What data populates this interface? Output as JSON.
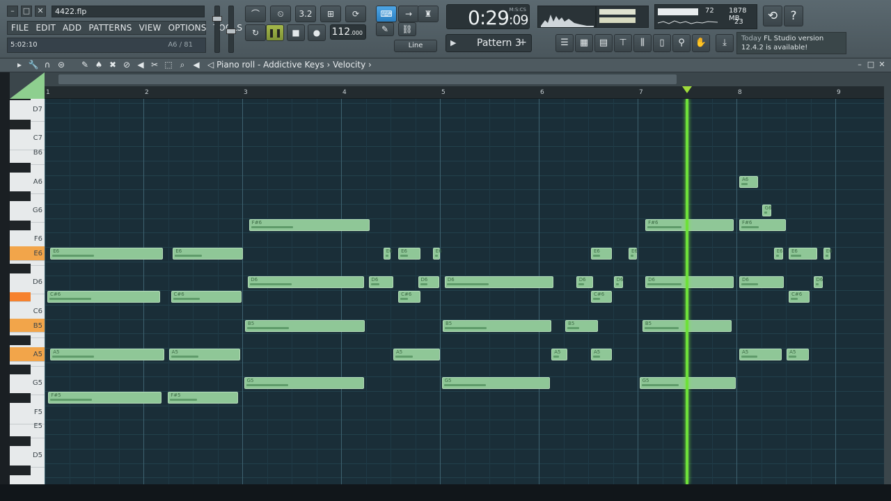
{
  "window": {
    "filename": "4422.flp"
  },
  "menu": [
    "FILE",
    "EDIT",
    "ADD",
    "PATTERNS",
    "VIEW",
    "OPTIONS",
    "TOOLS",
    "?"
  ],
  "hint": {
    "left": "5:02:10",
    "right": "A6 / 81"
  },
  "transport": {
    "tempo_main": "112",
    "tempo_decimal": ".000",
    "snap_label": "Line",
    "counter_label": "3.2"
  },
  "time": {
    "main": "0:29",
    "sub": ":09",
    "format": "M:S:CS"
  },
  "cpu": {
    "cpu_value": "72",
    "memory": "1878 MB",
    "voices": "23"
  },
  "pattern": {
    "label": "Pattern 3"
  },
  "news": {
    "today": "Today",
    "line1": "FL Studio version",
    "line2": "12.4.2 is available!"
  },
  "pianoroll": {
    "breadcrumb": "Piano roll - Addictive Keys",
    "sep": "›",
    "target": "Velocity"
  },
  "bars": [
    "1",
    "2",
    "3",
    "4",
    "5",
    "6",
    "7",
    "8",
    "9"
  ],
  "key_labels": [
    "D7",
    "C7",
    "B6",
    "A6",
    "G6",
    "F6",
    "E6",
    "D6",
    "C6",
    "B5",
    "A5",
    "G5",
    "F5",
    "E5",
    "D5"
  ],
  "notes": [
    {
      "n": "E6",
      "b": 0.03,
      "len": 1.17
    },
    {
      "n": "E6",
      "b": 1.27,
      "len": 0.74
    },
    {
      "n": "E6",
      "b": 3.4,
      "len": 0.1
    },
    {
      "n": "E6",
      "b": 3.55,
      "len": 0.25
    },
    {
      "n": "E6",
      "b": 3.9,
      "len": 0.1
    },
    {
      "n": "E6",
      "b": 5.5,
      "len": 0.24
    },
    {
      "n": "E6",
      "b": 5.88,
      "len": 0.11
    },
    {
      "n": "E6",
      "b": 7.35,
      "len": 0.12
    },
    {
      "n": "E6",
      "b": 7.5,
      "len": 0.32
    },
    {
      "n": "E6",
      "b": 7.85,
      "len": 0.1
    },
    {
      "n": "C#6",
      "b": 0.0,
      "len": 1.17
    },
    {
      "n": "C#6",
      "b": 1.25,
      "len": 0.74
    },
    {
      "n": "C#6",
      "b": 3.55,
      "len": 0.25
    },
    {
      "n": "C#6",
      "b": 5.5,
      "len": 0.24
    },
    {
      "n": "C#6",
      "b": 7.5,
      "len": 0.24
    },
    {
      "n": "F#6",
      "b": 2.04,
      "len": 1.25
    },
    {
      "n": "F#6",
      "b": 6.05,
      "len": 0.92
    },
    {
      "n": "F#6",
      "b": 7.0,
      "len": 0.5
    },
    {
      "n": "D6",
      "b": 2.03,
      "len": 1.2
    },
    {
      "n": "D6",
      "b": 3.25,
      "len": 0.28
    },
    {
      "n": "D6",
      "b": 3.75,
      "len": 0.24
    },
    {
      "n": "D6",
      "b": 4.02,
      "len": 1.13
    },
    {
      "n": "D6",
      "b": 5.35,
      "len": 0.2
    },
    {
      "n": "D6",
      "b": 5.73,
      "len": 0.12
    },
    {
      "n": "D6",
      "b": 6.05,
      "len": 0.92
    },
    {
      "n": "D6",
      "b": 7.0,
      "len": 0.48
    },
    {
      "n": "D6",
      "b": 7.75,
      "len": 0.12
    },
    {
      "n": "B5",
      "b": 2.0,
      "len": 1.24
    },
    {
      "n": "B5",
      "b": 4.0,
      "len": 1.13
    },
    {
      "n": "B5",
      "b": 5.24,
      "len": 0.36
    },
    {
      "n": "B5",
      "b": 6.02,
      "len": 0.93
    },
    {
      "n": "A5",
      "b": 0.03,
      "len": 1.18
    },
    {
      "n": "A5",
      "b": 1.23,
      "len": 0.75
    },
    {
      "n": "A5",
      "b": 3.5,
      "len": 0.5
    },
    {
      "n": "A5",
      "b": 5.1,
      "len": 0.19
    },
    {
      "n": "A5",
      "b": 5.5,
      "len": 0.24
    },
    {
      "n": "A5",
      "b": 7.0,
      "len": 0.46
    },
    {
      "n": "A5",
      "b": 7.48,
      "len": 0.25
    },
    {
      "n": "G5",
      "b": 1.99,
      "len": 1.24
    },
    {
      "n": "G5",
      "b": 3.99,
      "len": 1.12
    },
    {
      "n": "G5",
      "b": 5.99,
      "len": 1.0
    },
    {
      "n": "F#5",
      "b": 0.01,
      "len": 1.17
    },
    {
      "n": "F#5",
      "b": 1.22,
      "len": 0.74
    },
    {
      "n": "A6",
      "b": 7.0,
      "len": 0.22
    },
    {
      "n": "G6",
      "b": 7.23,
      "len": 0.12
    }
  ],
  "playhead_bar": 6.5
}
